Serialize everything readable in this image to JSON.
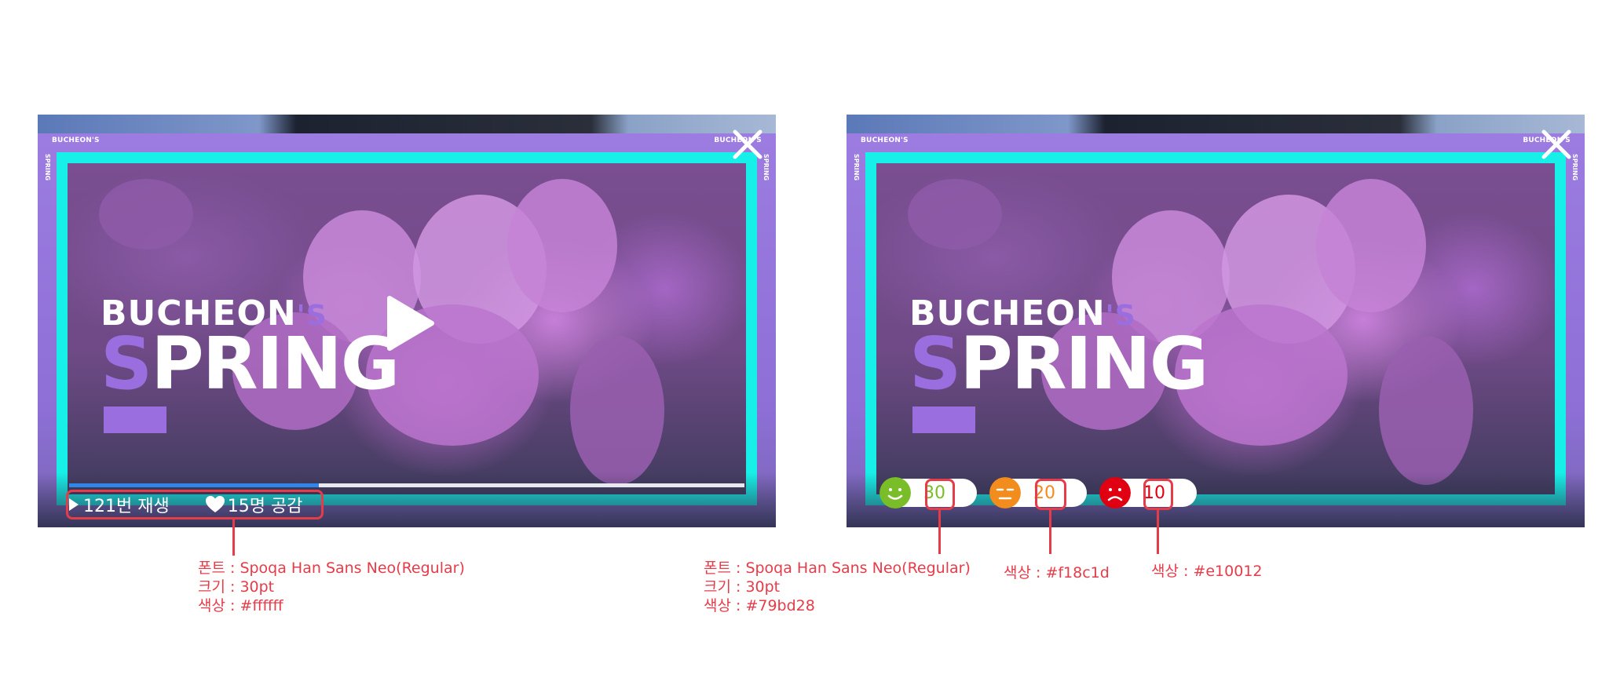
{
  "players": [
    {
      "brand_top": "BUCHEON'S",
      "brand_side": "SPRING",
      "logo_line1": "BUCHEON",
      "logo_line1_s": "'S",
      "logo_line2_s": "S",
      "logo_line2": "PRING",
      "progress_fraction": 0.37,
      "play_count": "121번 재생",
      "like_count": "15명 공감",
      "icons": [
        "play-icon",
        "close-icon",
        "heart-icon",
        "play-small-icon"
      ]
    },
    {
      "brand_top": "BUCHEON'S",
      "brand_side": "SPRING",
      "logo_line1": "BUCHEON",
      "logo_line1_s": "'S",
      "logo_line2_s": "S",
      "logo_line2": "PRING",
      "reactions": [
        {
          "icon": "smile-face-icon",
          "count": "30",
          "color": "#79bd28"
        },
        {
          "icon": "neutral-face-icon",
          "count": "20",
          "color": "#f18c1d"
        },
        {
          "icon": "sad-face-icon",
          "count": "10",
          "color": "#e10012"
        }
      ]
    }
  ],
  "annotations": {
    "left": {
      "font": "폰트 : Spoqa Han Sans Neo(Regular)",
      "size": "크기 : 30pt",
      "color": "색상 : #ffffff"
    },
    "right_green": {
      "font": "폰트 : Spoqa Han Sans Neo(Regular)",
      "size": "크기 : 30pt",
      "color": "색상 : #79bd28"
    },
    "right_orange": {
      "color": "색상 : #f18c1d"
    },
    "right_red": {
      "color": "색상 : #e10012"
    }
  },
  "colors": {
    "frame": "#17f0e8",
    "purple": "#9b6ee0",
    "progress": "#2f86e8",
    "annotation": "#e63c4a"
  }
}
